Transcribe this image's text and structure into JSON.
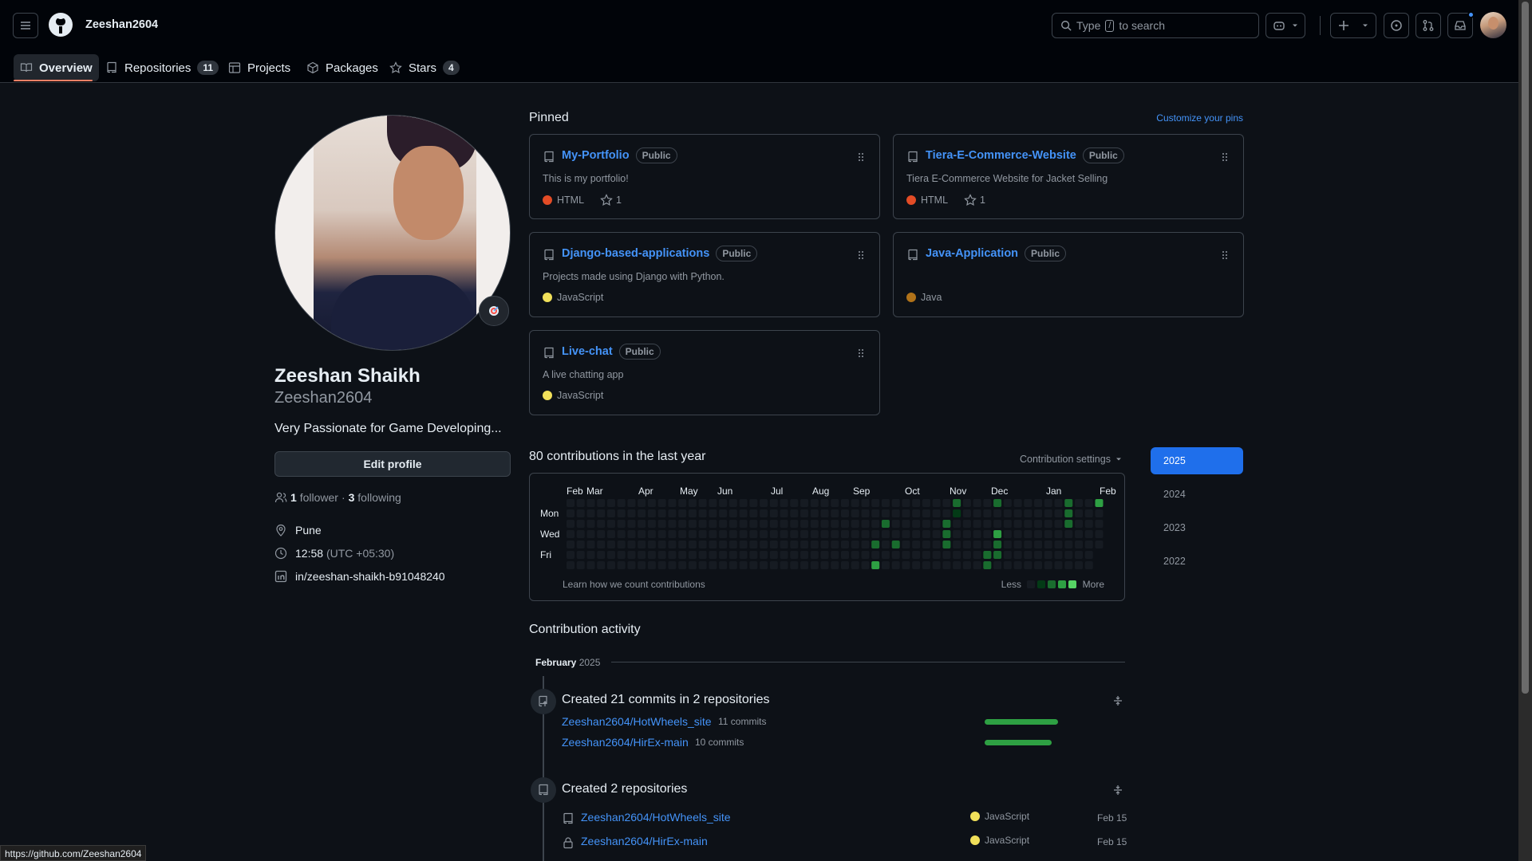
{
  "header": {
    "username": "Zeeshan2604",
    "search_placeholder_pre": "Type",
    "search_key": "/",
    "search_placeholder_post": "to search"
  },
  "tabs": [
    {
      "label": "Overview"
    },
    {
      "label": "Repositories",
      "count": "11"
    },
    {
      "label": "Projects"
    },
    {
      "label": "Packages"
    },
    {
      "label": "Stars",
      "count": "4"
    }
  ],
  "profile": {
    "name": "Zeeshan Shaikh",
    "login": "Zeeshan2604",
    "bio": "Very Passionate for Game Developing...",
    "edit_label": "Edit profile",
    "followers": "1",
    "followers_label": "follower",
    "sep": "·",
    "following": "3",
    "following_label": "following",
    "location": "Pune",
    "time": "12:58",
    "tz": "(UTC +05:30)",
    "linkedin": "in/zeeshan-shaikh-b91048240"
  },
  "pinned": {
    "title": "Pinned",
    "customize": "Customize your pins",
    "repos": [
      {
        "name": "My-Portfolio",
        "badge": "Public",
        "desc": "This is my portfolio!",
        "lang": "HTML",
        "lang_color": "#e34c26",
        "stars": "1"
      },
      {
        "name": "Tiera-E-Commerce-Website",
        "badge": "Public",
        "desc": "Tiera E-Commerce Website for Jacket Selling",
        "lang": "HTML",
        "lang_color": "#e34c26",
        "stars": "1"
      },
      {
        "name": "Django-based-applications",
        "badge": "Public",
        "desc": "Projects made using Django with Python.",
        "lang": "JavaScript",
        "lang_color": "#f1e05a",
        "stars": ""
      },
      {
        "name": "Java-Application",
        "badge": "Public",
        "desc": "",
        "lang": "Java",
        "lang_color": "#b07219",
        "stars": ""
      },
      {
        "name": "Live-chat",
        "badge": "Public",
        "desc": "A live chatting app",
        "lang": "JavaScript",
        "lang_color": "#f1e05a",
        "stars": ""
      }
    ]
  },
  "contrib": {
    "title": "80 contributions in the last year",
    "settings": "Contribution settings",
    "months": [
      "Feb",
      "Mar",
      "Apr",
      "May",
      "Jun",
      "Jul",
      "Aug",
      "Sep",
      "Oct",
      "Nov",
      "Dec",
      "Jan",
      "Feb"
    ],
    "days": [
      "Mon",
      "Wed",
      "Fri"
    ],
    "learn": "Learn how we count contributions",
    "less": "Less",
    "more": "More",
    "years": [
      "2025",
      "2024",
      "2023",
      "2022"
    ],
    "active_year": "2025",
    "level_colors": [
      "#161b22",
      "#033a16",
      "#196c2e",
      "#2ea043",
      "#56d364"
    ]
  },
  "activity": {
    "title": "Contribution activity",
    "month": "February",
    "year": "2025",
    "commits_title": "Created 21 commits in 2 repositories",
    "commits": [
      {
        "repo": "Zeeshan2604/HotWheels_site",
        "count": "11 commits",
        "share": 1.0
      },
      {
        "repo": "Zeeshan2604/HirEx-main",
        "count": "10 commits",
        "share": 0.91
      }
    ],
    "created_title": "Created 2 repositories",
    "created": [
      {
        "repo": "Zeeshan2604/HotWheels_site",
        "lang": "JavaScript",
        "date": "Feb 15"
      },
      {
        "repo": "Zeeshan2604/HirEx-main",
        "lang": "JavaScript",
        "date": "Feb 15"
      }
    ]
  },
  "status_url": "https://github.com/Zeeshan2604"
}
